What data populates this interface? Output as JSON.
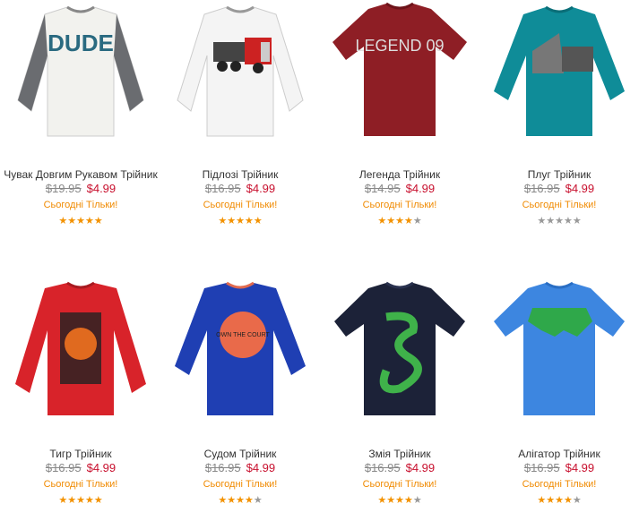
{
  "products": [
    {
      "name": "Чувак Довгим Рукавом Трійник",
      "was": "$19.95",
      "now": "$4.99",
      "promo": "Сьогодні Тільки!",
      "rating": 5,
      "gray": false,
      "print_text": "DUDE"
    },
    {
      "name": "Підлозі Трійник",
      "was": "$16.95",
      "now": "$4.99",
      "promo": "Сьогодні Тільки!",
      "rating": 5,
      "gray": false,
      "print_text": ""
    },
    {
      "name": "Легенда Трійник",
      "was": "$14.95",
      "now": "$4.99",
      "promo": "Сьогодні Тільки!",
      "rating": 4,
      "gray": false,
      "print_text": "LEGEND 09"
    },
    {
      "name": "Плуг Трійник",
      "was": "$16.95",
      "now": "$4.99",
      "promo": "Сьогодні Тільки!",
      "rating": 5,
      "gray": true,
      "print_text": ""
    },
    {
      "name": "Тигр Трійник",
      "was": "$16.95",
      "now": "$4.99",
      "promo": "Сьогодні Тільки!",
      "rating": 5,
      "gray": false,
      "print_text": ""
    },
    {
      "name": "Судом Трійник",
      "was": "$16.95",
      "now": "$4.99",
      "promo": "Сьогодні Тільки!",
      "rating": 4,
      "gray": false,
      "print_text": "OWN THE COURT"
    },
    {
      "name": "Змія Трійник",
      "was": "$16.95",
      "now": "$4.99",
      "promo": "Сьогодні Тільки!",
      "rating": 4,
      "gray": false,
      "print_text": ""
    },
    {
      "name": "Алігатор Трійник",
      "was": "$16.95",
      "now": "$4.99",
      "promo": "Сьогодні Тільки!",
      "rating": 4,
      "gray": false,
      "print_text": ""
    }
  ],
  "colors": {
    "price_now": "#c8102e",
    "promo": "#f08a00",
    "star": "#f39200"
  }
}
